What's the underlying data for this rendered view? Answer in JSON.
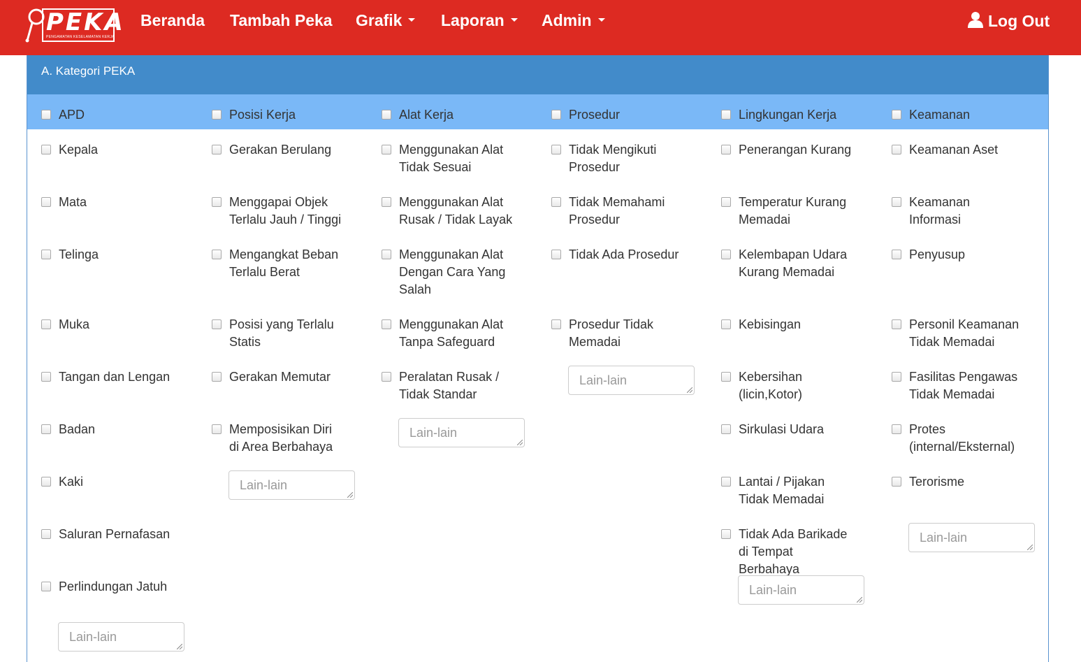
{
  "nav": {
    "logo_text": "PEKA",
    "logo_sub": "PENGAMATAN KESELAMATAN KERJA",
    "links": [
      {
        "label": "Beranda"
      },
      {
        "label": "Tambah Peka"
      },
      {
        "label": "Grafik"
      },
      {
        "label": "Laporan"
      },
      {
        "label": "Admin"
      }
    ],
    "logout": "Log Out"
  },
  "colors": {
    "navbar": "#dd2a22",
    "panel_heading": "#428bca",
    "category_row": "#7ab8f7"
  },
  "panel": {
    "title": "A. Kategori PEKA"
  },
  "categories": [
    {
      "label": "APD",
      "items": [
        "Kepala",
        "Mata",
        "Telinga",
        "Muka",
        "Tangan dan Lengan",
        "Badan",
        "Kaki",
        "Saluran Pernafasan",
        "Perlindungan Jatuh"
      ],
      "other_placeholder": "Lain-lain"
    },
    {
      "label": "Posisi Kerja",
      "items": [
        "Gerakan Berulang",
        "Menggapai Objek Terlalu Jauh / Tinggi",
        "Mengangkat Beban Terlalu Berat",
        "Posisi yang Terlalu Statis",
        "Gerakan Memutar",
        "Memposisikan Diri di Area Berbahaya"
      ],
      "other_placeholder": "Lain-lain"
    },
    {
      "label": "Alat Kerja",
      "items": [
        "Menggunakan Alat Tidak Sesuai",
        "Menggunakan Alat Rusak / Tidak Layak",
        "Menggunakan Alat Dengan Cara Yang Salah",
        "Menggunakan Alat Tanpa Safeguard",
        "Peralatan Rusak / Tidak Standar"
      ],
      "other_placeholder": "Lain-lain"
    },
    {
      "label": "Prosedur",
      "items": [
        "Tidak Mengikuti Prosedur",
        "Tidak Memahami Prosedur",
        "Tidak Ada Prosedur",
        "Prosedur Tidak Memadai"
      ],
      "other_placeholder": "Lain-lain"
    },
    {
      "label": "Lingkungan Kerja",
      "items": [
        "Penerangan Kurang",
        "Temperatur Kurang Memadai",
        "Kelembapan Udara Kurang Memadai",
        "Kebisingan",
        "Kebersihan (licin,Kotor)",
        "Sirkulasi Udara",
        "Lantai / Pijakan Tidak Memadai",
        "Tidak Ada Barikade di Tempat Berbahaya"
      ],
      "other_placeholder": "Lain-lain"
    },
    {
      "label": "Keamanan",
      "items": [
        "Keamanan Aset",
        "Keamanan Informasi",
        "Penyusup",
        "Personil Keamanan Tidak Memadai",
        "Fasilitas Pengawas Tidak Memadai",
        "Protes (internal/Eksternal)",
        "Terorisme"
      ],
      "other_placeholder": "Lain-lain"
    }
  ]
}
